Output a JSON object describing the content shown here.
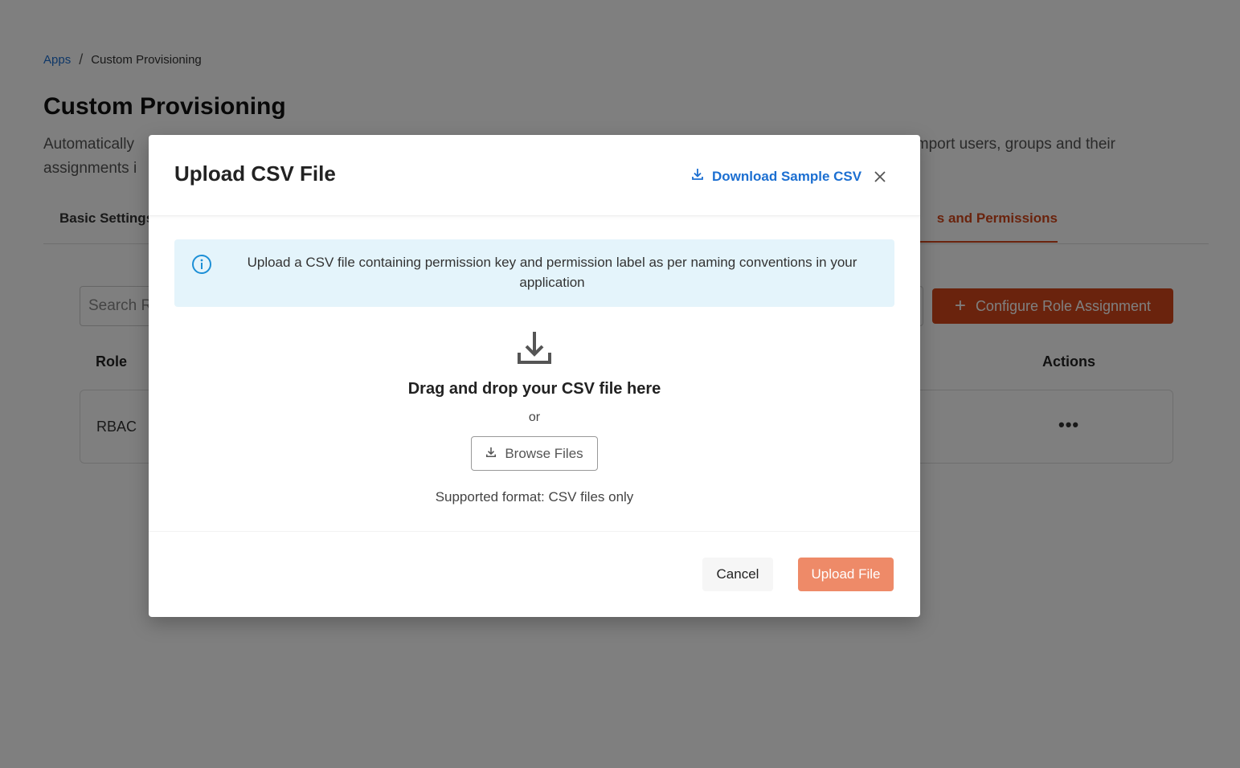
{
  "breadcrumb": {
    "root": "Apps",
    "separator": "/",
    "current": "Custom Provisioning"
  },
  "page": {
    "title": "Custom Provisioning",
    "description_left": "Automatically",
    "description_right": "import users, groups and their",
    "description_line2": "assignments i"
  },
  "tabs": {
    "basic": "Basic Settings",
    "roles_fragment": "s and Permissions"
  },
  "toolbar": {
    "search_placeholder": "Search R",
    "configure_label": "Configure Role Assignment"
  },
  "table": {
    "columns": {
      "role": "Role",
      "actions": "Actions"
    },
    "rows": [
      {
        "role": "RBAC",
        "actions": "•••"
      }
    ]
  },
  "modal": {
    "title": "Upload CSV File",
    "download_label": "Download Sample CSV",
    "info_text": "Upload a CSV file containing permission key and permission label as per naming conventions in your application",
    "drag_text": "Drag and drop your CSV file here",
    "or_text": "or",
    "browse_label": "Browse Files",
    "format_text": "Supported format: CSV files only",
    "cancel_label": "Cancel",
    "upload_label": "Upload File"
  },
  "colors": {
    "accent": "#d4471b",
    "link": "#1c6fd1",
    "upload_button": "#ee8a68",
    "info_bg": "#e4f4fb"
  },
  "icons": [
    "download-icon",
    "close-icon",
    "info-icon",
    "upload-tray-icon",
    "plus-icon",
    "more-icon"
  ]
}
